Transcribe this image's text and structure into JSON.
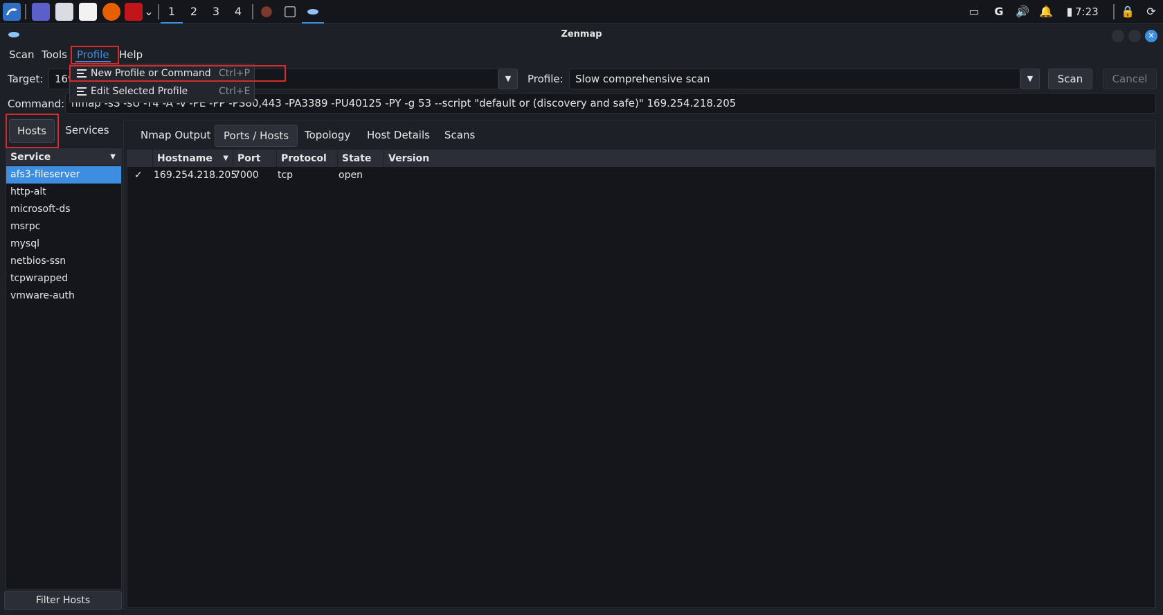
{
  "taskbar": {
    "workspaces": [
      "1",
      "2",
      "3",
      "4"
    ],
    "active_workspace": "1",
    "clock": "7:23",
    "colors": {
      "accent": "#3d8ee0"
    }
  },
  "window": {
    "title": "Zenmap"
  },
  "menubar": {
    "items": [
      "Scan",
      "Tools",
      "Profile",
      "Help"
    ],
    "active": "Profile"
  },
  "profile_menu": {
    "items": [
      {
        "label": "New Profile or Command",
        "accel": "Ctrl+P"
      },
      {
        "label": "Edit Selected Profile",
        "accel": "Ctrl+E"
      }
    ]
  },
  "toolbar": {
    "target_label": "Target:",
    "target_value": "169",
    "profile_label": "Profile:",
    "profile_value": "Slow comprehensive scan",
    "scan_label": "Scan",
    "cancel_label": "Cancel",
    "command_label": "Command:",
    "command_value": "nmap -sS -sU -T4 -A -v -PE -PP -PS80,443 -PA3389 -PU40125 -PY -g 53 --script \"default or (discovery and safe)\" 169.254.218.205"
  },
  "left_panel": {
    "hosts_label": "Hosts",
    "services_label": "Services",
    "list_header": "Service",
    "services": [
      "afs3-fileserver",
      "http-alt",
      "microsoft-ds",
      "msrpc",
      "mysql",
      "netbios-ssn",
      "tcpwrapped",
      "vmware-auth"
    ],
    "selected": "afs3-fileserver",
    "filter_label": "Filter Hosts"
  },
  "right_panel": {
    "tabs": [
      "Nmap Output",
      "Ports / Hosts",
      "Topology",
      "Host Details",
      "Scans"
    ],
    "active_tab": "Ports / Hosts",
    "columns": [
      "Hostname",
      "Port",
      "Protocol",
      "State",
      "Version"
    ],
    "rows": [
      {
        "status": "✓",
        "hostname": "169.254.218.205",
        "port": "7000",
        "protocol": "tcp",
        "state": "open",
        "version": ""
      }
    ]
  }
}
